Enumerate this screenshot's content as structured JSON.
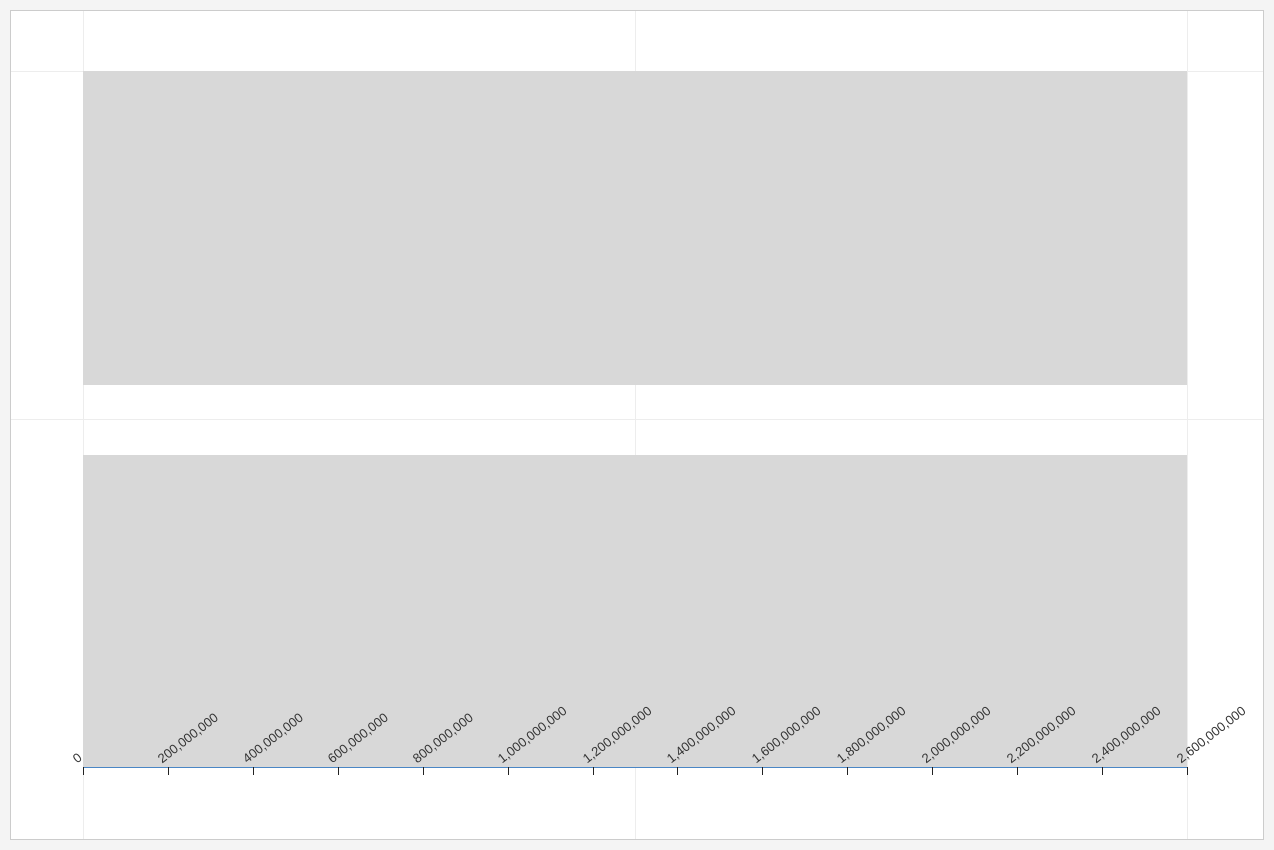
{
  "chart_data": {
    "type": "bar",
    "title": "",
    "xlabel": "",
    "ylabel": "",
    "x_ticks": [
      "0",
      "200,000,000",
      "400,000,000",
      "600,000,000",
      "800,000,000",
      "1,000,000,000",
      "1,200,000,000",
      "1,400,000,000",
      "1,600,000,000",
      "1,800,000,000",
      "2,000,000,000",
      "2,200,000,000",
      "2,400,000,000",
      "2,600,000,000"
    ],
    "x_range": [
      0,
      2600000000
    ],
    "categories": [
      "",
      ""
    ],
    "values": [
      2600000000,
      2600000000
    ],
    "bar_color": "#d8d8d8",
    "axis_color": "#4a86c5"
  }
}
